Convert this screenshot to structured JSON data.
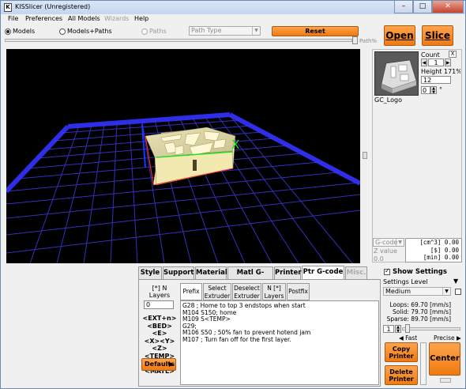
{
  "window": {
    "title": "KISSlicer (Unregistered)",
    "minimize": "–",
    "maximize": "□",
    "close": "✕"
  },
  "menu": [
    "File",
    "Preferences",
    "All Models",
    "Wizards",
    "Help"
  ],
  "toolbar": {
    "radio_models": "Models",
    "radio_models_paths": "Models+Paths",
    "radio_paths": "Paths",
    "path_type": "Path Type",
    "reset": "Reset",
    "path_pct": "Path%",
    "open": "Open",
    "slice": "Slice"
  },
  "model": {
    "count_label": "Count",
    "count_value": "1",
    "height_label": "Height 171%",
    "height_value": "12",
    "rotation_value": "0",
    "degree": "°",
    "name": "GC_Logo",
    "close": "X"
  },
  "status": {
    "gcode_select": "G-code",
    "z_value_label": "Z value",
    "z_value": "0.0",
    "lines": [
      "[cm^3] 0.00",
      "[$] 0.00",
      "[min] 0.00"
    ]
  },
  "tabs": [
    "Style",
    "Support",
    "Material",
    "Matl G-code",
    "Printer",
    "Ptr G-code",
    "Misc."
  ],
  "active_tab": "Ptr G-code",
  "gcode": {
    "n_layers_label": "[*] N Layers",
    "n_layers_value": "0",
    "tokens": [
      "<EXT+n>",
      "<BED><E>",
      "<X><Y><Z>",
      "<TEMP><%>",
      "<MATL>"
    ],
    "defaults": "Defaults",
    "subtabs": [
      "Prefix",
      "Select Extruder",
      "Deselect Extruder",
      "N [*] Layers",
      "Postfix"
    ],
    "text": "G28 ; Home to top 3 endstops when start\nM104 S150; home\nM109 S<TEMP>\nG29;\nM106 S50 ; 50% fan to prevent hotend jam\nM107 ; Turn fan off for the first layer."
  },
  "settings": {
    "show_settings": "Show Settings",
    "level_label": "Settings Level",
    "level_value": "Medium",
    "loops": "Loops: 69.70 [mm/s]",
    "solid": "Solid: 79.70 [mm/s]",
    "sparse": "Sparse: 89.70 [mm/s]",
    "speed_value": "1",
    "fast": "Fast",
    "precise": "Precise",
    "copy_printer": "Copy Printer",
    "delete_printer": "Delete Printer",
    "center": "Center"
  }
}
